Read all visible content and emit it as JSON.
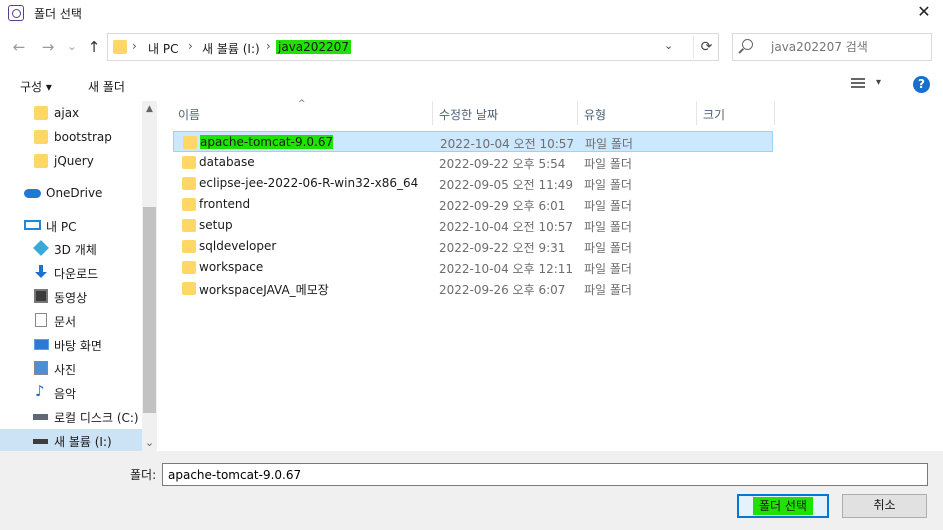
{
  "window": {
    "title": "폴더 선택",
    "close_glyph": "✕"
  },
  "nav": {
    "back": "←",
    "forward": "→",
    "recent": "⌄",
    "up": "↑",
    "breadcrumb": [
      "내 PC",
      "새 볼륨 (I:)",
      "java202207"
    ],
    "separator": "›",
    "dropdown": "⌄",
    "refresh": "⟳",
    "search_placeholder": "java202207 검색"
  },
  "toolbar": {
    "organize": "구성 ▾",
    "new_folder": "새 폴더",
    "view_dropdown": "▾",
    "help": "?"
  },
  "sidebar": {
    "items": [
      {
        "label": "ajax",
        "icon": "folder-icon"
      },
      {
        "label": "bootstrap",
        "icon": "folder-icon"
      },
      {
        "label": "jQuery",
        "icon": "folder-icon"
      },
      {
        "label": "OneDrive",
        "icon": "onedrive-icon"
      },
      {
        "label": "내 PC",
        "icon": "pc-icon"
      },
      {
        "label": "3D 개체",
        "icon": "3d-objects-icon"
      },
      {
        "label": "다운로드",
        "icon": "download-icon"
      },
      {
        "label": "동영상",
        "icon": "video-icon"
      },
      {
        "label": "문서",
        "icon": "document-icon"
      },
      {
        "label": "바탕 화면",
        "icon": "desktop-icon"
      },
      {
        "label": "사진",
        "icon": "picture-icon"
      },
      {
        "label": "음악",
        "icon": "music-icon"
      },
      {
        "label": "로컬 디스크 (C:)",
        "icon": "drive-icon"
      },
      {
        "label": "새 볼륨 (I:)",
        "icon": "drive-icon"
      }
    ],
    "scroll_up": "▲",
    "scroll_down": "⌄"
  },
  "columns": {
    "name": "이름",
    "modified": "수정한 날짜",
    "type": "유형",
    "size": "크기",
    "sort_glyph": "^"
  },
  "files": [
    {
      "name": "apache-tomcat-9.0.67",
      "modified": "2022-10-04 오전 10:57",
      "type": "파일 폴더"
    },
    {
      "name": "database",
      "modified": "2022-09-22 오후 5:54",
      "type": "파일 폴더"
    },
    {
      "name": "eclipse-jee-2022-06-R-win32-x86_64",
      "modified": "2022-09-05 오전 11:49",
      "type": "파일 폴더"
    },
    {
      "name": "frontend",
      "modified": "2022-09-29 오후 6:01",
      "type": "파일 폴더"
    },
    {
      "name": "setup",
      "modified": "2022-10-04 오전 10:57",
      "type": "파일 폴더"
    },
    {
      "name": "sqldeveloper",
      "modified": "2022-09-22 오전 9:31",
      "type": "파일 폴더"
    },
    {
      "name": "workspace",
      "modified": "2022-10-04 오후 12:11",
      "type": "파일 폴더"
    },
    {
      "name": "workspaceJAVA_메모장",
      "modified": "2022-09-26 오후 6:07",
      "type": "파일 폴더"
    }
  ],
  "bottom": {
    "folder_label": "폴더:",
    "folder_value": "apache-tomcat-9.0.67",
    "select_button": "폴더 선택",
    "cancel_button": "취소"
  }
}
